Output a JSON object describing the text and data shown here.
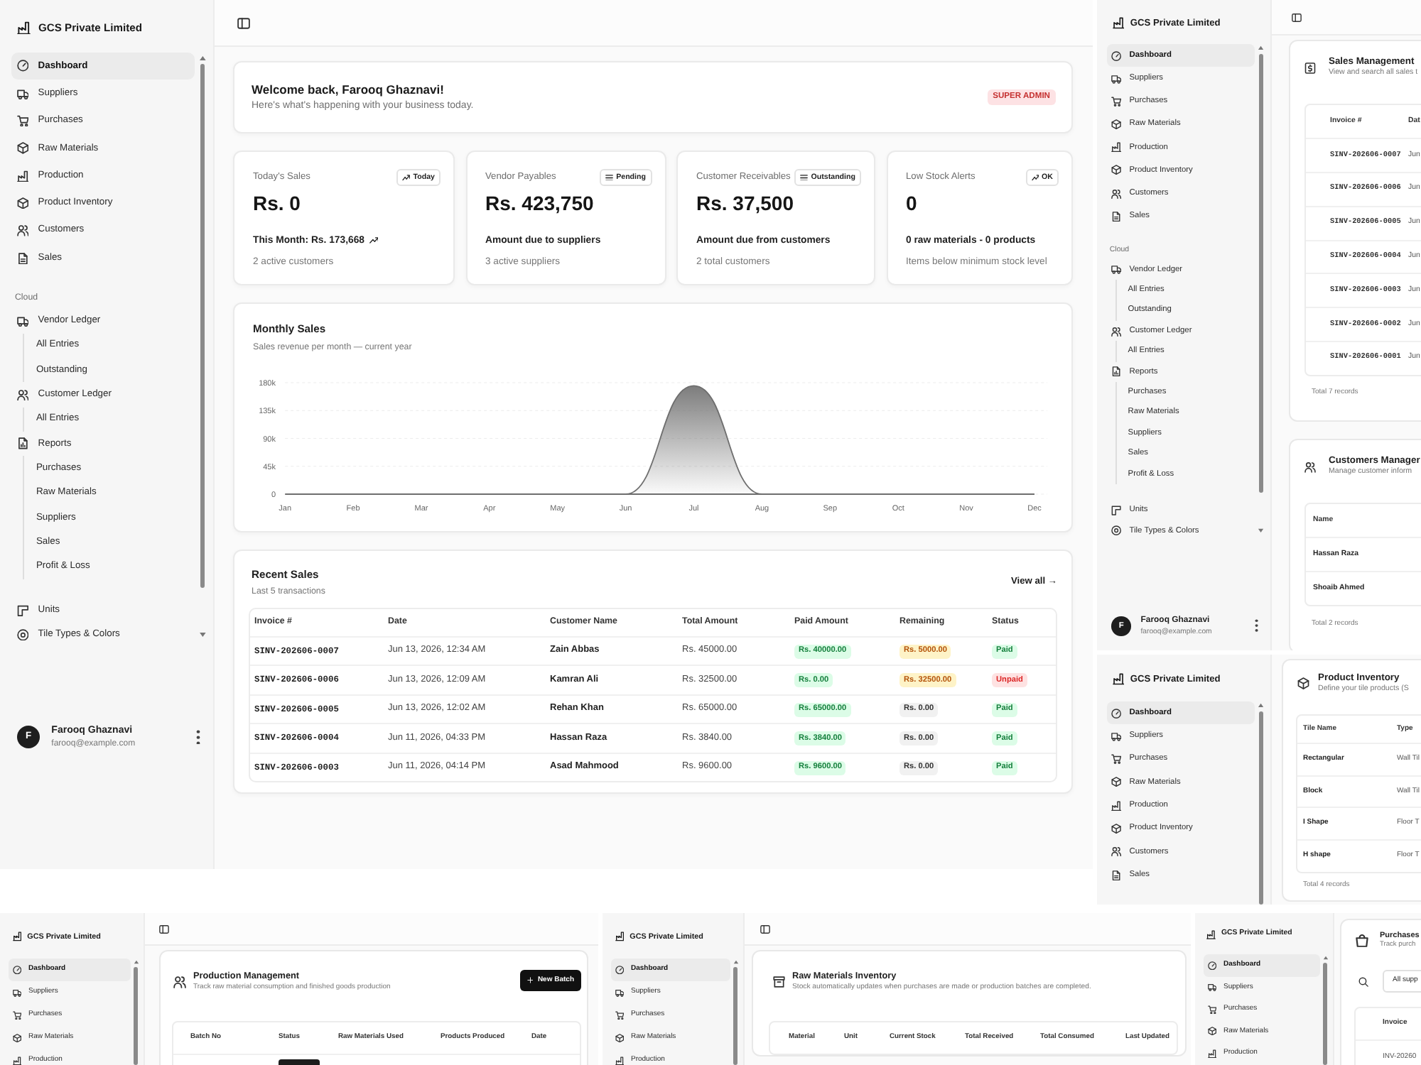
{
  "windows": [
    {
      "kind": "dashboard",
      "toolbar": true,
      "sidebar": {
        "brand": "GCS Private Limited",
        "items": [
          {
            "label": "Dashboard",
            "selected": true
          },
          {
            "label": "Suppliers",
            "selected": false
          },
          {
            "label": "Purchases",
            "selected": false
          },
          {
            "label": "Raw Materials",
            "selected": false
          },
          {
            "label": "Production",
            "selected": false
          },
          {
            "label": "Product Inventory",
            "selected": false
          },
          {
            "label": "Customers",
            "selected": false
          },
          {
            "label": "Sales",
            "selected": false
          }
        ],
        "section_label": "Cloud",
        "groups": [
          {
            "label": "Vendor Ledger",
            "selected": false,
            "children": [
              {
                "label": "All Entries",
                "selected": false
              },
              {
                "label": "Outstanding",
                "selected": false
              }
            ]
          },
          {
            "label": "Customer Ledger",
            "selected": false,
            "children": [
              {
                "label": "All Entries",
                "selected": false
              }
            ]
          },
          {
            "label": "Reports",
            "selected": false,
            "children": [
              {
                "label": "Purchases",
                "selected": false
              },
              {
                "label": "Raw Materials",
                "selected": false
              },
              {
                "label": "Suppliers",
                "selected": false
              },
              {
                "label": "Sales",
                "selected": false
              },
              {
                "label": "Profit & Loss",
                "selected": false
              }
            ]
          }
        ],
        "extras": [
          {
            "label": "Units",
            "selected": false
          },
          {
            "label": "Tile Types & Colors",
            "selected": false
          }
        ],
        "user": {
          "initial": "F",
          "name": "Farooq Ghaznavi",
          "email": "farooq@example.com"
        }
      },
      "welcome": {
        "title": "Welcome back, Farooq Ghaznavi!",
        "subtitle": "Here's what's happening with your business today.",
        "badge": "SUPER ADMIN"
      },
      "stats": [
        {
          "label": "Today's Sales",
          "badge": "Today",
          "value": "Rs. 0",
          "detail": "This Month: Rs. 173,668",
          "note": "2 active customers"
        },
        {
          "label": "Vendor Payables",
          "badge": "Pending",
          "value": "Rs. 423,750",
          "detail": "Amount due to suppliers",
          "note": "3 active suppliers"
        },
        {
          "label": "Customer Receivables",
          "badge": "Outstanding",
          "value": "Rs. 37,500",
          "detail": "Amount due from customers",
          "note": "2 total customers"
        },
        {
          "label": "Low Stock Alerts",
          "badge": "OK",
          "value": "0",
          "detail": "0 raw materials - 0 products",
          "note": "Items below minimum stock level"
        }
      ],
      "monthly_sales": {
        "subtitle": "Sales revenue per month — current year",
        "chart_data": {
          "type": "area",
          "title": "Monthly Sales",
          "categories": [
            "Jan",
            "Feb",
            "Mar",
            "Apr",
            "May",
            "Jun",
            "Jul",
            "Aug",
            "Sep",
            "Oct",
            "Nov",
            "Dec"
          ],
          "series": [
            {
              "color": "#6e6e6e",
              "values": [
                0,
                0,
                0,
                0,
                0,
                0,
                175000,
                0,
                0,
                0,
                0,
                0
              ]
            }
          ],
          "ylim": [
            0,
            180000
          ],
          "yticks": [
            {
              "value": 0,
              "label": "0"
            },
            {
              "value": 45000,
              "label": "45k"
            },
            {
              "value": 90000,
              "label": "90k"
            },
            {
              "value": 135000,
              "label": "135k"
            },
            {
              "value": 180000,
              "label": "180k"
            }
          ],
          "grid": true
        }
      },
      "recent_sales": {
        "title": "Recent Sales",
        "subtitle": "Last 5 transactions",
        "link": "View all →",
        "columns": [
          "Invoice #",
          "Date",
          "Customer Name",
          "Total Amount",
          "Paid Amount",
          "Remaining",
          "Status"
        ],
        "rows": [
          {
            "invoice": "SINV-202606-0007",
            "date": "Jun 13, 2026, 12:34 AM",
            "customer": "Zain Abbas",
            "total": "Rs. 45000.00",
            "paid": "Rs. 40000.00",
            "remaining": "Rs. 5000.00",
            "remaining_due": true,
            "status": "Paid",
            "unpaid": false
          },
          {
            "invoice": "SINV-202606-0006",
            "date": "Jun 13, 2026, 12:09 AM",
            "customer": "Kamran Ali",
            "total": "Rs. 32500.00",
            "paid": "Rs. 0.00",
            "remaining": "Rs. 32500.00",
            "remaining_due": true,
            "status": "Unpaid",
            "unpaid": true
          },
          {
            "invoice": "SINV-202606-0005",
            "date": "Jun 13, 2026, 12:02 AM",
            "customer": "Rehan Khan",
            "total": "Rs. 65000.00",
            "paid": "Rs. 65000.00",
            "remaining": "Rs. 0.00",
            "remaining_due": false,
            "status": "Paid",
            "unpaid": false
          },
          {
            "invoice": "SINV-202606-0004",
            "date": "Jun 11, 2026, 04:33 PM",
            "customer": "Hassan Raza",
            "total": "Rs. 3840.00",
            "paid": "Rs. 3840.00",
            "remaining": "Rs. 0.00",
            "remaining_due": false,
            "status": "Paid",
            "unpaid": false
          },
          {
            "invoice": "SINV-202606-0003",
            "date": "Jun 11, 2026, 04:14 PM",
            "customer": "Asad Mahmood",
            "total": "Rs. 9600.00",
            "paid": "Rs. 9600.00",
            "remaining": "Rs. 0.00",
            "remaining_due": false,
            "status": "Paid",
            "unpaid": false
          }
        ]
      }
    },
    {
      "kind": "list",
      "toolbar": true,
      "sidebar": {
        "brand": "GCS Private Limited",
        "items": [
          {
            "label": "Dashboard",
            "selected": true
          },
          {
            "label": "Suppliers",
            "selected": false
          },
          {
            "label": "Purchases",
            "selected": false
          },
          {
            "label": "Raw Materials",
            "selected": false
          },
          {
            "label": "Production",
            "selected": false
          },
          {
            "label": "Product Inventory",
            "selected": false
          },
          {
            "label": "Customers",
            "selected": false
          },
          {
            "label": "Sales",
            "selected": false
          }
        ],
        "section_label": "Cloud",
        "groups": [
          {
            "label": "Vendor Ledger",
            "selected": false,
            "children": [
              {
                "label": "All Entries",
                "selected": false
              },
              {
                "label": "Outstanding",
                "selected": false
              }
            ]
          },
          {
            "label": "Customer Ledger",
            "selected": false,
            "children": [
              {
                "label": "All Entries",
                "selected": false
              }
            ]
          },
          {
            "label": "Reports",
            "selected": false,
            "children": [
              {
                "label": "Purchases",
                "selected": false
              },
              {
                "label": "Raw Materials",
                "selected": false
              },
              {
                "label": "Suppliers",
                "selected": false
              },
              {
                "label": "Sales",
                "selected": false
              },
              {
                "label": "Profit & Loss",
                "selected": false
              }
            ]
          }
        ],
        "extras": [
          {
            "label": "Units",
            "selected": false
          },
          {
            "label": "Tile Types & Colors",
            "selected": false
          }
        ],
        "user": {
          "initial": "F",
          "name": "Farooq Ghaznavi",
          "email": "farooq@example.com"
        }
      },
      "cards": [
        {
          "kind": "invoices",
          "title": "Sales Management",
          "subtitle": "View and search all sales t",
          "columns": [
            "Invoice #",
            "Dat"
          ],
          "rows": [
            [
              "SINV-202606-0007",
              "Jun"
            ],
            [
              "SINV-202606-0006",
              "Jun"
            ],
            [
              "SINV-202606-0005",
              "Jun"
            ],
            [
              "SINV-202606-0004",
              "Jun"
            ],
            [
              "SINV-202606-0003",
              "Jun"
            ],
            [
              "SINV-202606-0002",
              "Jun"
            ],
            [
              "SINV-202606-0001",
              "Jun"
            ]
          ],
          "footer": "Total 7 records"
        },
        {
          "kind": "records",
          "title": "Customers Manager",
          "subtitle": "Manage customer inform",
          "columns": [
            "Name"
          ],
          "rows": [
            [
              "Hassan Raza"
            ],
            [
              "Shoaib Ahmed"
            ]
          ],
          "footer": "Total 2 records"
        }
      ]
    },
    {
      "kind": "list",
      "sidebar": {
        "brand": "GCS Private Limited",
        "items": [
          {
            "label": "Dashboard",
            "selected": true
          },
          {
            "label": "Suppliers",
            "selected": false
          },
          {
            "label": "Purchases",
            "selected": false
          },
          {
            "label": "Raw Materials",
            "selected": false
          },
          {
            "label": "Production",
            "selected": false
          },
          {
            "label": "Product Inventory",
            "selected": false
          },
          {
            "label": "Customers",
            "selected": false
          },
          {
            "label": "Sales",
            "selected": false
          }
        ]
      },
      "cards": [
        {
          "kind": "records",
          "title": "Product Inventory",
          "subtitle": "Define your tile products (S",
          "columns": [
            "Tile Name",
            "Type"
          ],
          "rows": [
            [
              "Rectangular",
              "Wall Til"
            ],
            [
              "Block",
              "Wall Til"
            ],
            [
              "I Shape",
              "Floor T"
            ],
            [
              "H shape",
              "Floor T"
            ]
          ],
          "footer": "Total 4 records"
        }
      ]
    },
    {
      "kind": "list",
      "toolbar": true,
      "sidebar": {
        "brand": "GCS Private Limited",
        "items": [
          {
            "label": "Dashboard",
            "selected": true
          },
          {
            "label": "Suppliers",
            "selected": false
          },
          {
            "label": "Purchases",
            "selected": false
          },
          {
            "label": "Raw Materials",
            "selected": false
          },
          {
            "label": "Production",
            "selected": false
          }
        ]
      },
      "cards": [
        {
          "title": "Production Management",
          "subtitle": "Track raw material consumption and finished goods production",
          "button": "New Batch",
          "columns": [
            "Batch No",
            "Status",
            "Raw Materials Used",
            "Products Produced",
            "Date"
          ],
          "peek_status_badge": true
        }
      ]
    },
    {
      "kind": "list",
      "toolbar": true,
      "sidebar": {
        "brand": "GCS Private Limited",
        "items": [
          {
            "label": "Dashboard",
            "selected": true
          },
          {
            "label": "Suppliers",
            "selected": false
          },
          {
            "label": "Purchases",
            "selected": false
          },
          {
            "label": "Raw Materials",
            "selected": false
          },
          {
            "label": "Production",
            "selected": false
          }
        ]
      },
      "cards": [
        {
          "title": "Raw Materials Inventory",
          "subtitle": "Stock automatically updates when purchases are made or production batches are completed.",
          "columns": [
            "Material",
            "Unit",
            "Current Stock",
            "Total Received",
            "Total Consumed",
            "Last Updated"
          ]
        }
      ]
    },
    {
      "kind": "list",
      "sidebar": {
        "brand": "GCS Private Limited",
        "items": [
          {
            "label": "Dashboard",
            "selected": true
          },
          {
            "label": "Suppliers",
            "selected": false
          },
          {
            "label": "Purchases",
            "selected": false
          },
          {
            "label": "Raw Materials",
            "selected": false
          },
          {
            "label": "Production",
            "selected": false
          }
        ]
      },
      "cards": [
        {
          "title": "Purchases",
          "subtitle": "Track purch",
          "filter": "All supp",
          "columns": [
            "Invoice"
          ],
          "rows": [
            [
              "INV-20260"
            ]
          ]
        }
      ]
    }
  ]
}
